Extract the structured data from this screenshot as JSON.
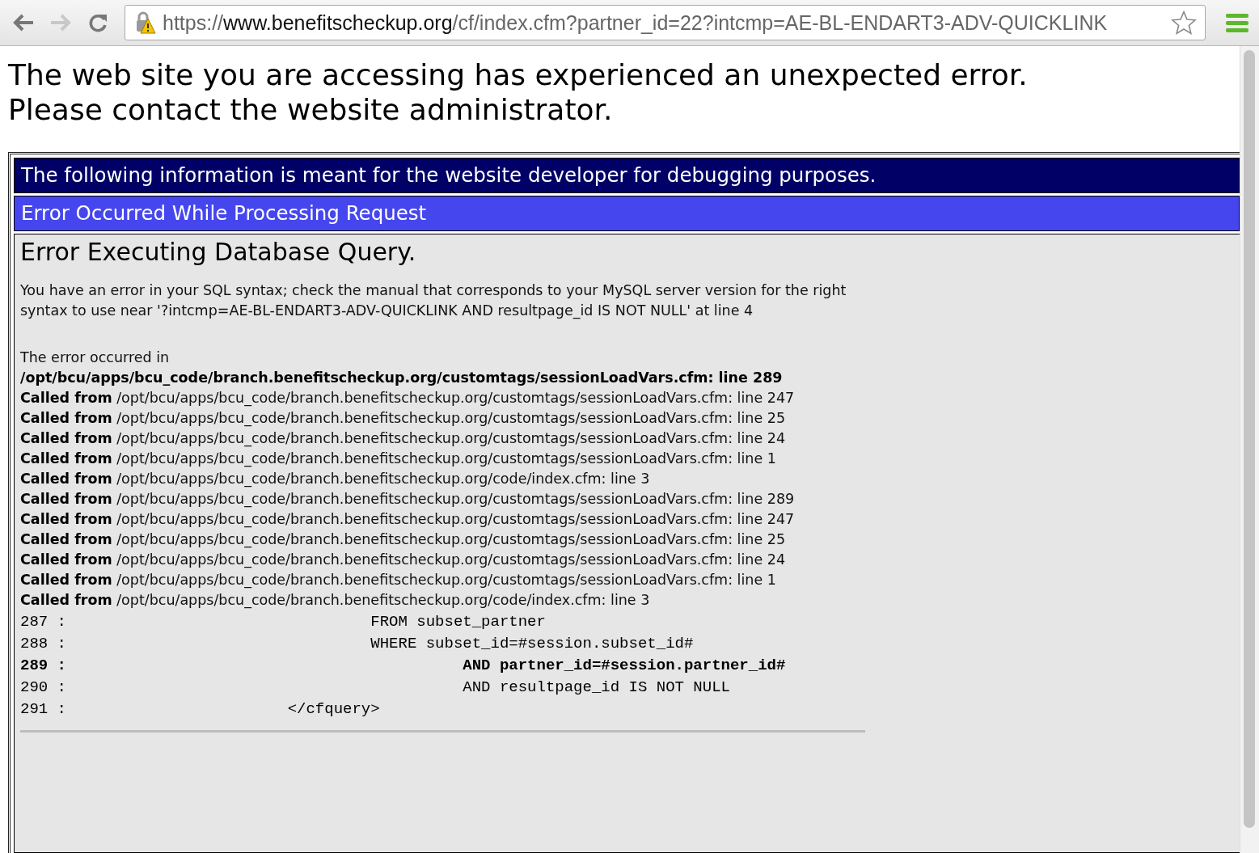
{
  "browser": {
    "url_scheme": "https://",
    "url_host": "www.benefitscheckup.org",
    "url_path": "/cf/index.cfm?partner_id=22?intcmp=AE-BL-ENDART3-ADV-QUICKLINK",
    "bookmarked": false
  },
  "heading": [
    "The web site you are accessing has experienced an unexpected error.",
    "Please contact the website administrator."
  ],
  "debug_banner": "The following information is meant for the website developer for debugging purposes.",
  "error_title": "Error Occurred While Processing Request",
  "error_heading": "Error Executing Database Query.",
  "error_message": "You have an error in your SQL syntax; check the manual that corresponds to your MySQL server version for the right syntax to use near '?intcmp=AE-BL-ENDART3-ADV-QUICKLINK AND resultpage_id IS NOT NULL' at line 4",
  "occurred_label": "The error occurred in",
  "trace": [
    "**/opt/bcu/apps/bcu_code/branch.benefitscheckup.org/customtags/sessionLoadVars.cfm: line 289**",
    "**Called from** /opt/bcu/apps/bcu_code/branch.benefitscheckup.org/customtags/sessionLoadVars.cfm: line 247",
    "**Called from** /opt/bcu/apps/bcu_code/branch.benefitscheckup.org/customtags/sessionLoadVars.cfm: line 25",
    "**Called from** /opt/bcu/apps/bcu_code/branch.benefitscheckup.org/customtags/sessionLoadVars.cfm: line 24",
    "**Called from** /opt/bcu/apps/bcu_code/branch.benefitscheckup.org/customtags/sessionLoadVars.cfm: line 1",
    "**Called from** /opt/bcu/apps/bcu_code/branch.benefitscheckup.org/code/index.cfm: line 3",
    "**Called from** /opt/bcu/apps/bcu_code/branch.benefitscheckup.org/customtags/sessionLoadVars.cfm: line 289",
    "**Called from** /opt/bcu/apps/bcu_code/branch.benefitscheckup.org/customtags/sessionLoadVars.cfm: line 247",
    "**Called from** /opt/bcu/apps/bcu_code/branch.benefitscheckup.org/customtags/sessionLoadVars.cfm: line 25",
    "**Called from** /opt/bcu/apps/bcu_code/branch.benefitscheckup.org/customtags/sessionLoadVars.cfm: line 24",
    "**Called from** /opt/bcu/apps/bcu_code/branch.benefitscheckup.org/customtags/sessionLoadVars.cfm: line 1",
    "**Called from** /opt/bcu/apps/bcu_code/branch.benefitscheckup.org/code/index.cfm: line 3"
  ],
  "code_lines": [
    {
      "number": "287 :",
      "code": "                                FROM subset_partner",
      "highlighted": false
    },
    {
      "number": "288 :",
      "code": "                                WHERE subset_id=#session.subset_id#",
      "highlighted": false
    },
    {
      "number": "289 :",
      "code": "                                          AND partner_id=#session.partner_id#",
      "highlighted": true
    },
    {
      "number": "290 :",
      "code": "                                          AND resultpage_id IS NOT NULL",
      "highlighted": false
    },
    {
      "number": "291 :",
      "code": "                       </cfquery>",
      "highlighted": false
    }
  ]
}
